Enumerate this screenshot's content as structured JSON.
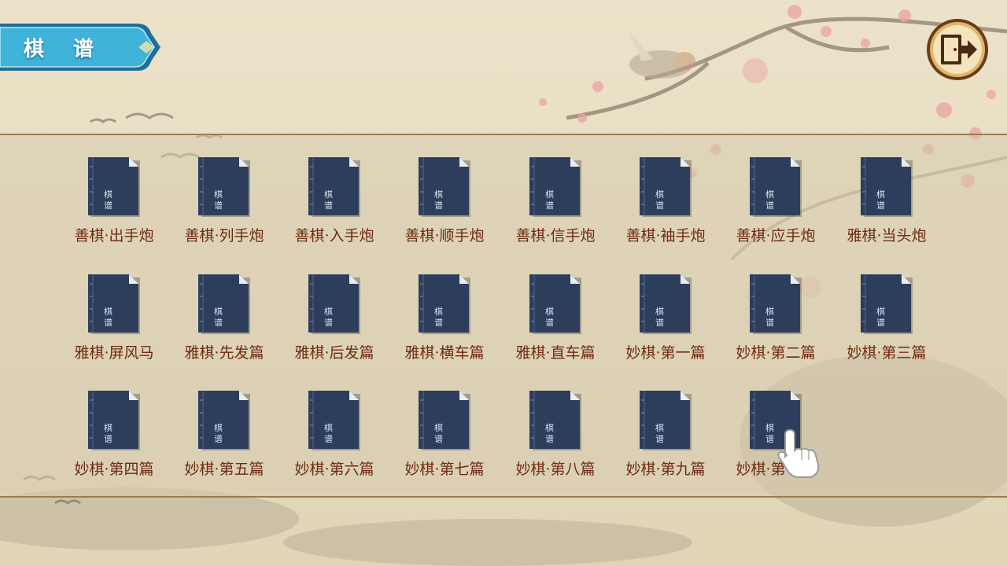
{
  "header": {
    "title": "棋 谱",
    "exit_icon": "exit-door-icon"
  },
  "book_icon_text": [
    "棋",
    "谱"
  ],
  "books": [
    {
      "label": "善棋·出手炮"
    },
    {
      "label": "善棋·列手炮"
    },
    {
      "label": "善棋·入手炮"
    },
    {
      "label": "善棋·顺手炮"
    },
    {
      "label": "善棋·信手炮"
    },
    {
      "label": "善棋·袖手炮"
    },
    {
      "label": "善棋·应手炮"
    },
    {
      "label": "雅棋·当头炮"
    },
    {
      "label": "雅棋·屏风马"
    },
    {
      "label": "雅棋·先发篇"
    },
    {
      "label": "雅棋·后发篇"
    },
    {
      "label": "雅棋·横车篇"
    },
    {
      "label": "雅棋·直车篇"
    },
    {
      "label": "妙棋·第一篇"
    },
    {
      "label": "妙棋·第二篇"
    },
    {
      "label": "妙棋·第三篇"
    },
    {
      "label": "妙棋·第四篇"
    },
    {
      "label": "妙棋·第五篇"
    },
    {
      "label": "妙棋·第六篇"
    },
    {
      "label": "妙棋·第七篇"
    },
    {
      "label": "妙棋·第八篇"
    },
    {
      "label": "妙棋·第九篇"
    },
    {
      "label": "妙棋·第十篇"
    }
  ],
  "colors": {
    "book_cover": "#2d3d5c",
    "label_text": "#6e2a12",
    "banner": "#2fa3c8",
    "panel_border": "#9b7b52"
  }
}
